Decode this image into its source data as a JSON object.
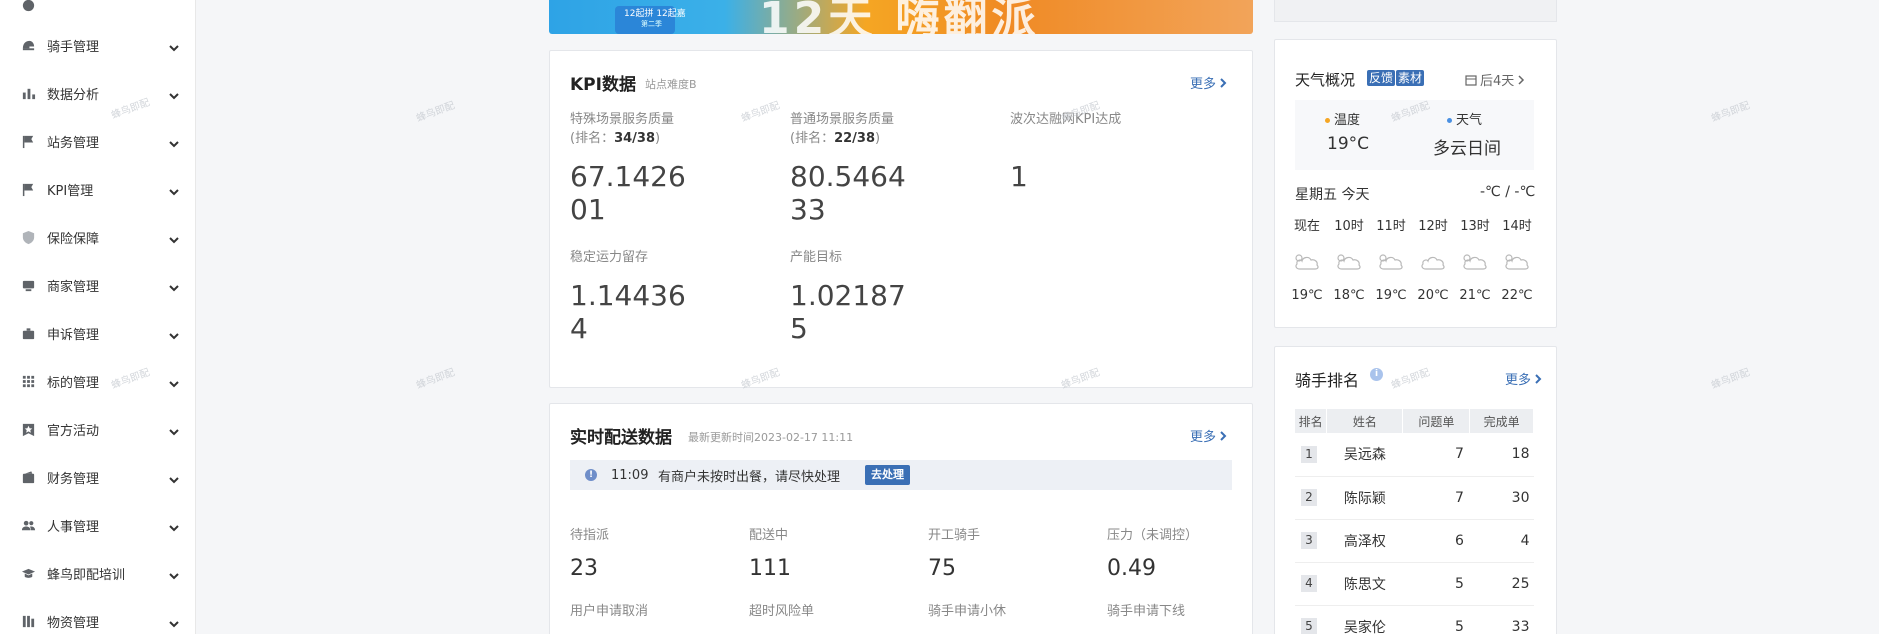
{
  "sidebar": {
    "items": [
      {
        "label": "骑手管理",
        "icon": "helmet-icon"
      },
      {
        "label": "数据分析",
        "icon": "bar-chart-icon"
      },
      {
        "label": "站务管理",
        "icon": "flag-icon"
      },
      {
        "label": "KPI管理",
        "icon": "flag-icon"
      },
      {
        "label": "保险保障",
        "icon": "shield-icon"
      },
      {
        "label": "商家管理",
        "icon": "store-icon"
      },
      {
        "label": "申诉管理",
        "icon": "briefcase-icon"
      },
      {
        "label": "标的管理",
        "icon": "grid-icon"
      },
      {
        "label": "官方活动",
        "icon": "star-badge-icon"
      },
      {
        "label": "财务管理",
        "icon": "wallet-icon"
      },
      {
        "label": "人事管理",
        "icon": "people-icon"
      },
      {
        "label": "蜂鸟即配培训",
        "icon": "graduation-cap-icon"
      },
      {
        "label": "物资管理",
        "icon": "package-icon"
      }
    ]
  },
  "banner": {
    "sticker": "12起拼 12起嘉",
    "sticker_sub": "第二季",
    "big_text": "12天 嗨翻派"
  },
  "kpi": {
    "title": "KPI数据",
    "subtitle": "站点难度B",
    "more": "更多",
    "metrics": [
      {
        "label": "特殊场景服务质量",
        "rank_prefix": "(排名：",
        "rank": "34/38",
        "rank_suffix": ")",
        "value": "67.142601"
      },
      {
        "label": "普通场景服务质量",
        "rank_prefix": "(排名：",
        "rank": "22/38",
        "rank_suffix": ")",
        "value": "80.546433"
      },
      {
        "label": "波次达融网KPI达成",
        "value": "1"
      },
      {
        "label": "稳定运力留存",
        "value": "1.144364"
      },
      {
        "label": "产能目标",
        "value": "1.021875"
      }
    ]
  },
  "realtime": {
    "title": "实时配送数据",
    "update": "最新更新时间2023-02-17 11:11",
    "more": "更多",
    "notice_time": "11:09",
    "notice_msg": "有商户未按时出餐，请尽快处理",
    "notice_button": "去处理",
    "stats": [
      {
        "label": "待指派",
        "value": "23"
      },
      {
        "label": "配送中",
        "value": "111"
      },
      {
        "label": "开工骑手",
        "value": "75"
      },
      {
        "label": "压力（未调控）",
        "value": "0.49"
      }
    ],
    "stats2": [
      "用户申请取消",
      "超时风险单",
      "骑手申请小休",
      "骑手申请下线"
    ]
  },
  "weather": {
    "title": "天气概况",
    "tag_feedback": "反馈",
    "tag_material": "素材",
    "tag_feedback_color": "#3a6fb5",
    "tag_material_color": "#3a6fb5",
    "forecast_link": "后4天",
    "temp_label": "温度",
    "temp_value": "19°C",
    "cond_label": "天气",
    "cond_value": "多云日间",
    "day": "星期五 今天",
    "range": "-℃ / -℃",
    "hours": [
      "现在",
      "10时",
      "11时",
      "12时",
      "13时",
      "14时"
    ],
    "temps": [
      "19℃",
      "18℃",
      "19℃",
      "20℃",
      "21℃",
      "22℃"
    ],
    "hour_icon": "cloudy-icon"
  },
  "ranking": {
    "title": "骑手排名",
    "more": "更多",
    "columns": [
      "排名",
      "姓名",
      "问题单",
      "完成单"
    ],
    "rows": [
      {
        "rank": "1",
        "name": "吴远森",
        "issues": "7",
        "done": "18"
      },
      {
        "rank": "2",
        "name": "陈际颖",
        "issues": "7",
        "done": "30"
      },
      {
        "rank": "3",
        "name": "高泽权",
        "issues": "6",
        "done": "4"
      },
      {
        "rank": "4",
        "name": "陈思文",
        "issues": "5",
        "done": "25"
      },
      {
        "rank": "5",
        "name": "吴家伦",
        "issues": "5",
        "done": "33"
      }
    ]
  },
  "watermark": "蜂鸟即配"
}
